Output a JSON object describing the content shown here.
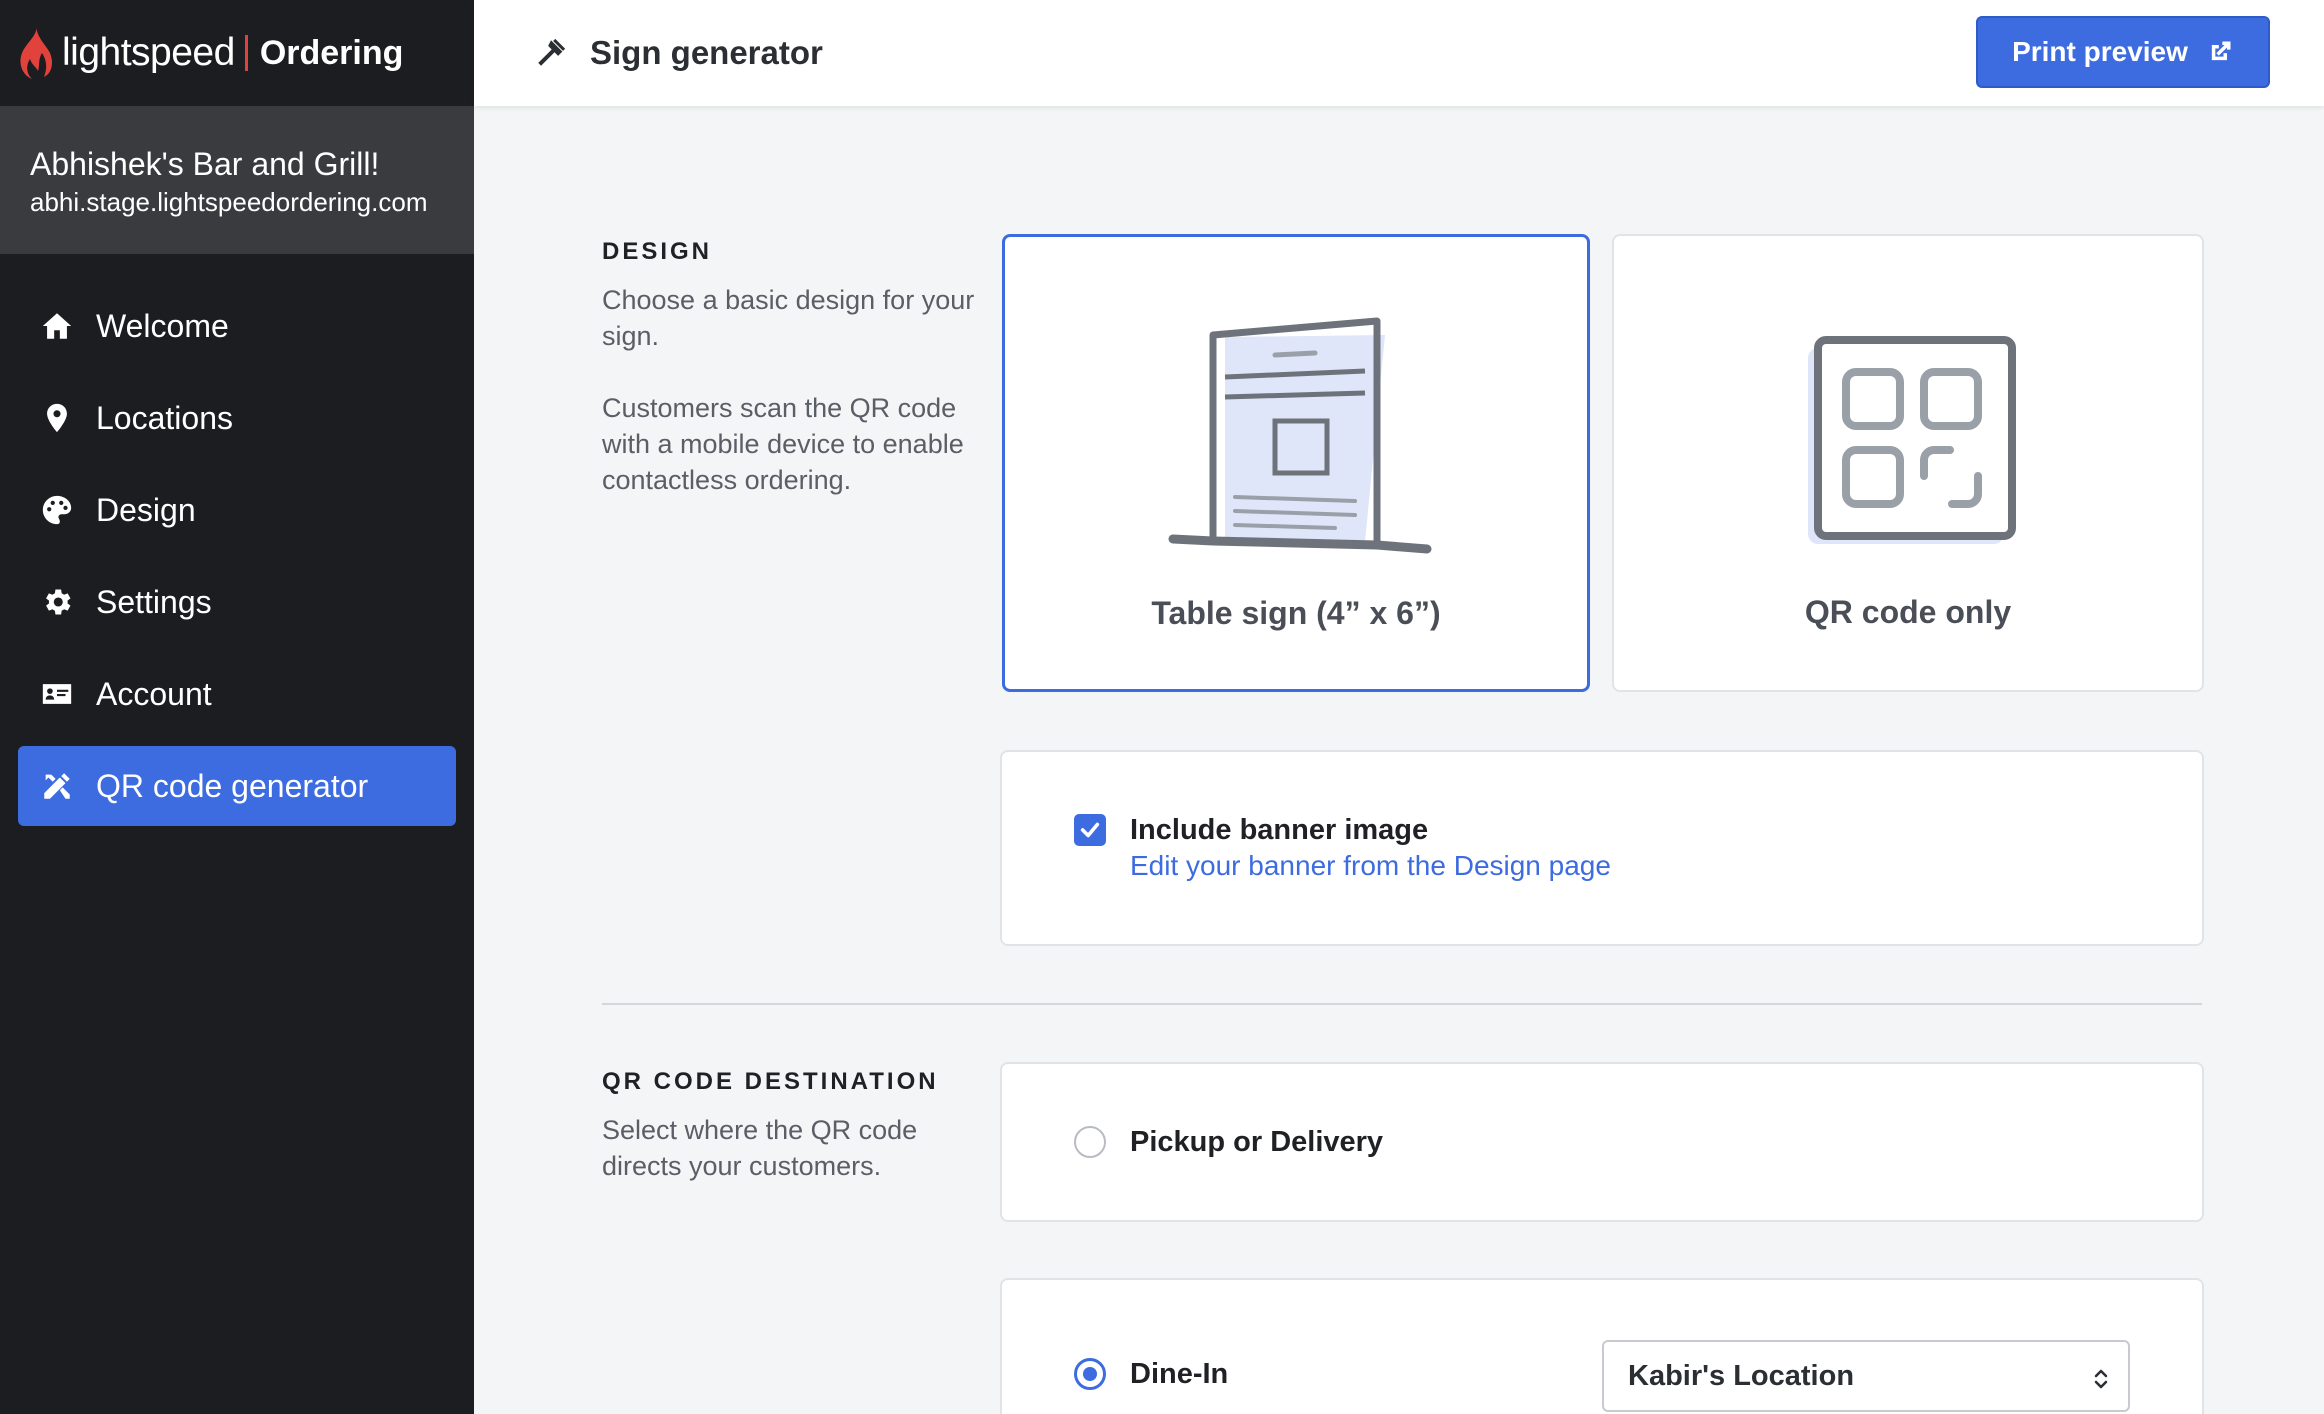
{
  "brand": {
    "name": "lightspeed",
    "product": "Ordering"
  },
  "store": {
    "name": "Abhishek's Bar and Grill!",
    "url": "abhi.stage.lightspeedordering.com"
  },
  "nav": [
    {
      "label": "Welcome",
      "icon": "home-icon"
    },
    {
      "label": "Locations",
      "icon": "map-pin-icon"
    },
    {
      "label": "Design",
      "icon": "palette-icon"
    },
    {
      "label": "Settings",
      "icon": "gear-icon"
    },
    {
      "label": "Account",
      "icon": "id-card-icon"
    },
    {
      "label": "QR code generator",
      "icon": "tools-icon",
      "active": true
    }
  ],
  "header": {
    "title": "Sign generator",
    "print_label": "Print preview"
  },
  "design": {
    "label": "DESIGN",
    "desc1": "Choose a basic design for your sign.",
    "desc2": "Customers scan the QR code with a mobile device to enable contactless ordering.",
    "options": [
      {
        "caption": "Table sign (4” x 6”)",
        "selected": true
      },
      {
        "caption": "QR code only",
        "selected": false
      }
    ],
    "banner": {
      "label": "Include banner image",
      "checked": true,
      "link": "Edit your banner from the Design page"
    }
  },
  "destination": {
    "label": "QR CODE DESTINATION",
    "desc": "Select where the QR code directs your customers.",
    "pickup_label": "Pickup or Delivery",
    "pickup_checked": false,
    "dinein_label": "Dine-In",
    "dinein_checked": true,
    "location_value": "Kabir's Location"
  },
  "colors": {
    "accent": "#3d6be0",
    "sidebar": "#1c1d20",
    "brand_red": "#e1423c"
  }
}
